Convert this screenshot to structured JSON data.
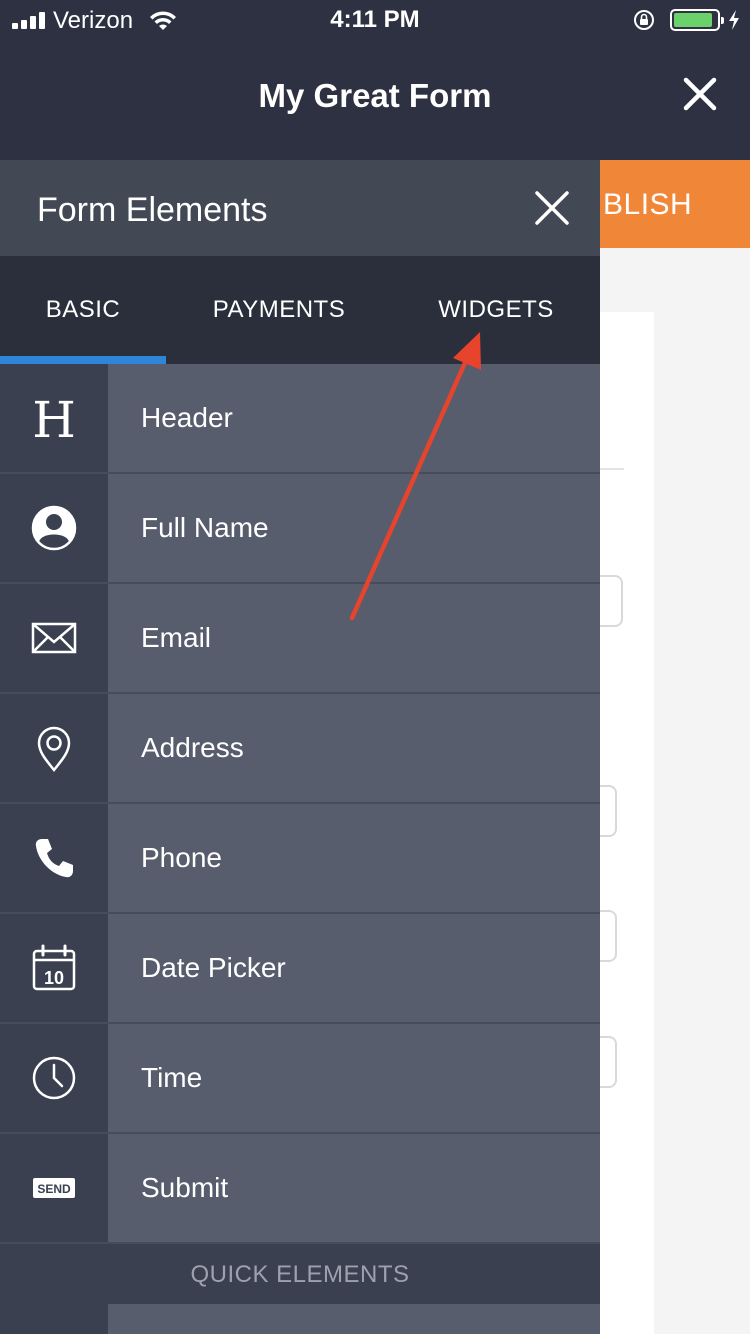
{
  "status_bar": {
    "carrier": "Verizon",
    "time": "4:11 PM",
    "battery_level": 0.9
  },
  "nav": {
    "title": "My Great Form"
  },
  "background": {
    "publish_label": "BLISH"
  },
  "drawer": {
    "title": "Form Elements",
    "tabs": [
      {
        "label": "BASIC",
        "active": true
      },
      {
        "label": "PAYMENTS",
        "active": false
      },
      {
        "label": "WIDGETS",
        "active": false
      }
    ],
    "items": [
      {
        "label": "Header",
        "icon": "header-icon"
      },
      {
        "label": "Full Name",
        "icon": "user-icon"
      },
      {
        "label": "Email",
        "icon": "envelope-icon"
      },
      {
        "label": "Address",
        "icon": "map-pin-icon"
      },
      {
        "label": "Phone",
        "icon": "phone-icon"
      },
      {
        "label": "Date Picker",
        "icon": "calendar-icon"
      },
      {
        "label": "Time",
        "icon": "clock-icon"
      },
      {
        "label": "Submit",
        "icon": "send-icon"
      }
    ],
    "section_label": "QUICK ELEMENTS"
  },
  "icon_text": {
    "header_glyph": "H",
    "calendar_day": "10",
    "send_text": "SEND"
  },
  "colors": {
    "nav_bg": "#2d3142",
    "publish_orange": "#f08637",
    "tab_indicator": "#2f86d8",
    "annotation_arrow": "#e8432c"
  }
}
